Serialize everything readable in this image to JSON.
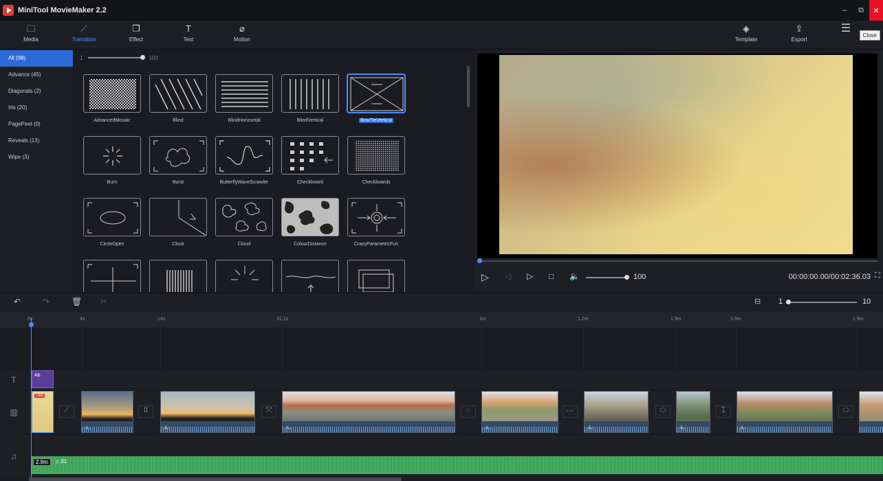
{
  "app": {
    "title": "MiniTool MovieMaker 2.2"
  },
  "window": {
    "minimize": "–",
    "maximize": "⧉",
    "close": "✕",
    "close_tooltip": "Close"
  },
  "toolbar": {
    "media": "Media",
    "transition": "Transition",
    "effect": "Effect",
    "text": "Text",
    "motion": "Motion",
    "template": "Template",
    "export": "Export"
  },
  "categories": [
    {
      "label": "All (98)"
    },
    {
      "label": "Advance (45)"
    },
    {
      "label": "Diagonals (2)"
    },
    {
      "label": "Iris (20)"
    },
    {
      "label": "PagePeel (0)"
    },
    {
      "label": "Reveals (13)"
    },
    {
      "label": "Wipe (3)"
    }
  ],
  "grid_slider": {
    "min": "1",
    "max": "100"
  },
  "transitions": [
    {
      "label": "AdvancedMosaic"
    },
    {
      "label": "Blind"
    },
    {
      "label": "BlindHorizontal"
    },
    {
      "label": "BlindVertical"
    },
    {
      "label": "BowTieVertical"
    },
    {
      "label": "Burn"
    },
    {
      "label": "Burst"
    },
    {
      "label": "ButterflyWaveScrawler"
    },
    {
      "label": "Checkboard"
    },
    {
      "label": "Checkboards"
    },
    {
      "label": "CircleOpen"
    },
    {
      "label": "Clock"
    },
    {
      "label": "Cloud"
    },
    {
      "label": "ColourDistance"
    },
    {
      "label": "CrazyParametricFun"
    }
  ],
  "player": {
    "volume": "100",
    "timecode": "00:00:00.00/00:02:36.03"
  },
  "timeline": {
    "zoom_min": "1",
    "zoom_max": "10",
    "ruler": [
      "0s",
      "4s",
      "14s",
      "31.1s",
      "1m",
      "1.2m",
      "1.5m",
      "1.6m",
      "1.9m"
    ],
    "title_clip": "Ab",
    "first_clip_tag": "Title",
    "audio_label": "2.9m",
    "audio_label2": "♫ 01"
  },
  "colors": {
    "accent": "#2d6ad7",
    "close_red": "#e81123",
    "audio_green": "#2e8a4a"
  }
}
